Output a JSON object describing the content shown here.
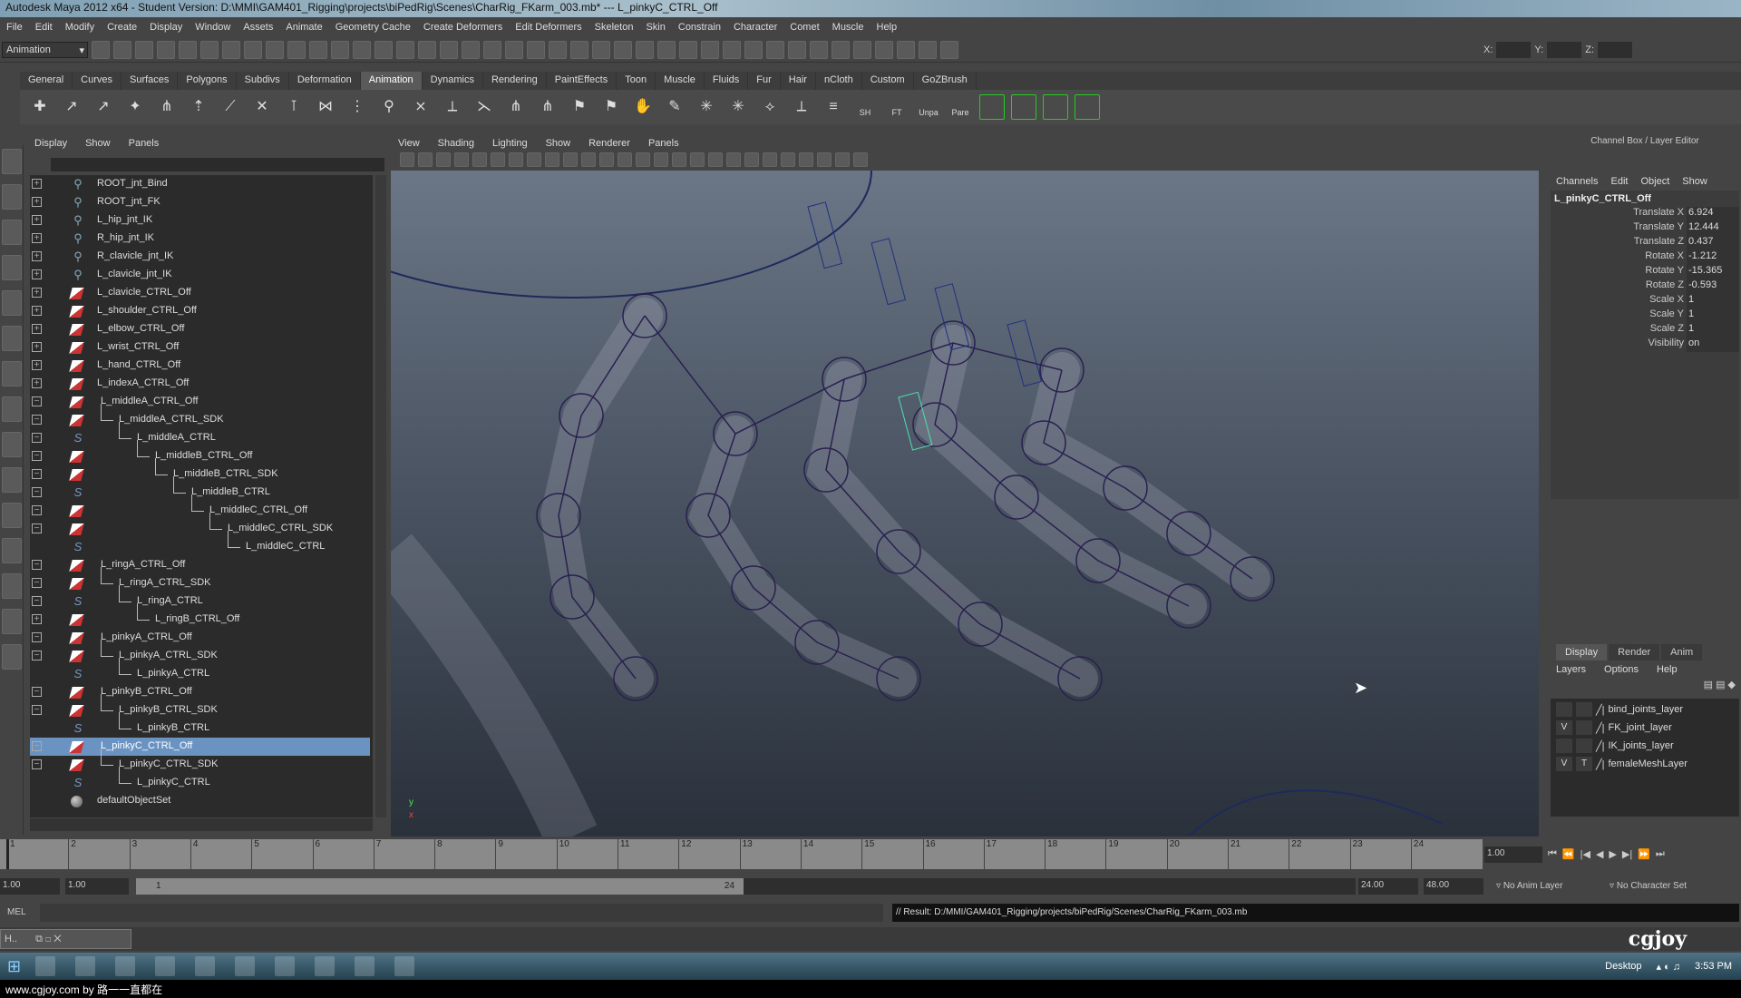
{
  "title": "Autodesk Maya 2012 x64 - Student Version: D:\\MMI\\GAM401_Rigging\\projects\\biPedRig\\Scenes\\CharRig_FKarm_003.mb*   ---   L_pinkyC_CTRL_Off",
  "menu": [
    "File",
    "Edit",
    "Modify",
    "Create",
    "Display",
    "Window",
    "Assets",
    "Animate",
    "Geometry Cache",
    "Create Deformers",
    "Edit Deformers",
    "Skeleton",
    "Skin",
    "Constrain",
    "Character",
    "Comet",
    "Muscle",
    "Help"
  ],
  "toolbar": {
    "menu_set": "Animation",
    "x_label": "X:",
    "y_label": "Y:",
    "z_label": "Z:"
  },
  "shelf": {
    "tabs": [
      "General",
      "Curves",
      "Surfaces",
      "Polygons",
      "Subdivs",
      "Deformation",
      "Animation",
      "Dynamics",
      "Rendering",
      "PaintEffects",
      "Toon",
      "Muscle",
      "Fluids",
      "Fur",
      "Hair",
      "nCloth",
      "Custom",
      "GoZBrush"
    ],
    "active": "Animation",
    "labels": [
      "SH",
      "FT",
      "Unpa",
      "Pare"
    ]
  },
  "outliner": {
    "menu": [
      "Display",
      "Show",
      "Panels"
    ],
    "items": [
      {
        "label": "ROOT_jnt_Bind",
        "type": "joint",
        "exp": "+",
        "depth": 0
      },
      {
        "label": "ROOT_jnt_FK",
        "type": "joint",
        "exp": "+",
        "depth": 0
      },
      {
        "label": "L_hip_jnt_IK",
        "type": "joint",
        "exp": "+",
        "depth": 0
      },
      {
        "label": "R_hip_jnt_IK",
        "type": "joint",
        "exp": "+",
        "depth": 0
      },
      {
        "label": "R_clavicle_jnt_IK",
        "type": "joint",
        "exp": "+",
        "depth": 0
      },
      {
        "label": "L_clavicle_jnt_IK",
        "type": "joint",
        "exp": "+",
        "depth": 0
      },
      {
        "label": "L_clavicle_CTRL_Off",
        "type": "ctrl",
        "exp": "+",
        "depth": 0
      },
      {
        "label": "L_shoulder_CTRL_Off",
        "type": "ctrl",
        "exp": "+",
        "depth": 0
      },
      {
        "label": "L_elbow_CTRL_Off",
        "type": "ctrl",
        "exp": "+",
        "depth": 0
      },
      {
        "label": "L_wrist_CTRL_Off",
        "type": "ctrl",
        "exp": "+",
        "depth": 0
      },
      {
        "label": "L_hand_CTRL_Off",
        "type": "ctrl",
        "exp": "+",
        "depth": 0
      },
      {
        "label": "L_indexA_CTRL_Off",
        "type": "ctrl",
        "exp": "+",
        "depth": 0
      },
      {
        "label": "L_middleA_CTRL_Off",
        "type": "ctrl",
        "exp": "-",
        "depth": 0
      },
      {
        "label": "L_middleA_CTRL_SDK",
        "type": "ctrl",
        "exp": "-",
        "depth": 1
      },
      {
        "label": "L_middleA_CTRL",
        "type": "curve",
        "exp": "-",
        "depth": 2
      },
      {
        "label": "L_middleB_CTRL_Off",
        "type": "ctrl",
        "exp": "-",
        "depth": 3
      },
      {
        "label": "L_middleB_CTRL_SDK",
        "type": "ctrl",
        "exp": "-",
        "depth": 4
      },
      {
        "label": "L_middleB_CTRL",
        "type": "curve",
        "exp": "-",
        "depth": 5
      },
      {
        "label": "L_middleC_CTRL_Off",
        "type": "ctrl",
        "exp": "-",
        "depth": 6
      },
      {
        "label": "L_middleC_CTRL_SDK",
        "type": "ctrl",
        "exp": "-",
        "depth": 7
      },
      {
        "label": "L_middleC_CTRL",
        "type": "curve",
        "exp": "",
        "depth": 8
      },
      {
        "label": "L_ringA_CTRL_Off",
        "type": "ctrl",
        "exp": "-",
        "depth": 0
      },
      {
        "label": "L_ringA_CTRL_SDK",
        "type": "ctrl",
        "exp": "-",
        "depth": 1
      },
      {
        "label": "L_ringA_CTRL",
        "type": "curve",
        "exp": "-",
        "depth": 2
      },
      {
        "label": "L_ringB_CTRL_Off",
        "type": "ctrl",
        "exp": "+",
        "depth": 3
      },
      {
        "label": "L_pinkyA_CTRL_Off",
        "type": "ctrl",
        "exp": "-",
        "depth": 0
      },
      {
        "label": "L_pinkyA_CTRL_SDK",
        "type": "ctrl",
        "exp": "-",
        "depth": 1
      },
      {
        "label": "L_pinkyA_CTRL",
        "type": "curve",
        "exp": "",
        "depth": 2
      },
      {
        "label": "L_pinkyB_CTRL_Off",
        "type": "ctrl",
        "exp": "-",
        "depth": 0
      },
      {
        "label": "L_pinkyB_CTRL_SDK",
        "type": "ctrl",
        "exp": "-",
        "depth": 1
      },
      {
        "label": "L_pinkyB_CTRL",
        "type": "curve",
        "exp": "",
        "depth": 2
      },
      {
        "label": "L_pinkyC_CTRL_Off",
        "type": "ctrl",
        "exp": "-",
        "depth": 0,
        "selected": true
      },
      {
        "label": "L_pinkyC_CTRL_SDK",
        "type": "ctrl",
        "exp": "-",
        "depth": 1
      },
      {
        "label": "L_pinkyC_CTRL",
        "type": "curve",
        "exp": "",
        "depth": 2
      },
      {
        "label": "defaultObjectSet",
        "type": "set",
        "exp": "",
        "depth": 0
      }
    ]
  },
  "viewport": {
    "menu": [
      "View",
      "Shading",
      "Lighting",
      "Show",
      "Renderer",
      "Panels"
    ],
    "axis_x": "x",
    "axis_y": "y",
    "bg_top": "#6b7686",
    "bg_bottom": "#2a313b",
    "wire_color": "#b8b8c8",
    "joint_color": "#2a2050",
    "selected_color": "#4fe0b0"
  },
  "channel_box": {
    "title": "Channel Box / Layer Editor",
    "menu": [
      "Channels",
      "Edit",
      "Object",
      "Show"
    ],
    "object": "L_pinkyC_CTRL_Off",
    "channels": [
      {
        "name": "Translate X",
        "value": "6.924"
      },
      {
        "name": "Translate Y",
        "value": "12.444"
      },
      {
        "name": "Translate Z",
        "value": "0.437"
      },
      {
        "name": "Rotate X",
        "value": "-1.212"
      },
      {
        "name": "Rotate Y",
        "value": "-15.365"
      },
      {
        "name": "Rotate Z",
        "value": "-0.593"
      },
      {
        "name": "Scale X",
        "value": "1"
      },
      {
        "name": "Scale Y",
        "value": "1"
      },
      {
        "name": "Scale Z",
        "value": "1"
      },
      {
        "name": "Visibility",
        "value": "on"
      }
    ]
  },
  "layer_editor": {
    "tabs": [
      "Display",
      "Render",
      "Anim"
    ],
    "active": "Display",
    "menu": [
      "Layers",
      "Options",
      "Help"
    ],
    "layers": [
      {
        "v": "",
        "t": "",
        "name": "bind_joints_layer"
      },
      {
        "v": "V",
        "t": "",
        "name": "FK_joint_layer"
      },
      {
        "v": "",
        "t": "",
        "name": "IK_joints_layer"
      },
      {
        "v": "V",
        "t": "T",
        "name": "femaleMeshLayer"
      }
    ]
  },
  "timeline": {
    "ticks": [
      "1",
      "2",
      "3",
      "4",
      "5",
      "6",
      "7",
      "8",
      "9",
      "10",
      "11",
      "12",
      "13",
      "14",
      "15",
      "16",
      "17",
      "18",
      "19",
      "20",
      "21",
      "22",
      "23",
      "24"
    ],
    "current_frame": "1.00"
  },
  "range": {
    "start": "1.00",
    "anim_start": "1.00",
    "slider_start": "1",
    "slider_end": "24",
    "end": "24.00",
    "anim_end": "48.00",
    "anim_layer": "No Anim Layer",
    "character_set": "No Character Set"
  },
  "mel": {
    "label": "MEL",
    "result": "// Result: D:/MMI/GAM401_Rigging/projects/biPedRig/Scenes/CharRig_FKarm_003.mb"
  },
  "minimized": {
    "label": "H.."
  },
  "taskbar": {
    "desktop": "Desktop",
    "clock": "3:53 PM"
  },
  "watermark": {
    "logo": "cgjoy",
    "footer": "www.cgjoy.com by 路一一直都在"
  }
}
